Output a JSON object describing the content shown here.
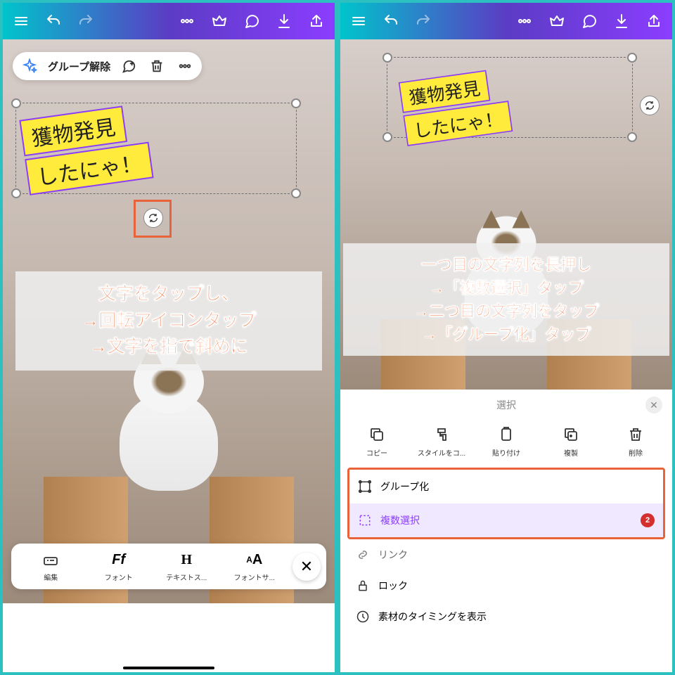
{
  "text_element": {
    "line1": "獲物発見",
    "line2": "したにゃ！"
  },
  "left": {
    "context_bar": {
      "ungroup": "グループ解除"
    },
    "instruction": {
      "l1": "文字をタップし、",
      "l2": "→回転アイコンタップ",
      "l3": "→文字を指で斜めに"
    },
    "tools": {
      "edit": "編集",
      "font": "フォント",
      "font_face": "Ff",
      "textstyle": "テキストス...",
      "textstyle_icon": "H",
      "fontsize": "フォントサ...",
      "fontsize_icon": "AA"
    }
  },
  "right": {
    "instruction": {
      "l1": "一つ目の文字列を長押し",
      "l2": "→「複数選択」タップ",
      "l3": "→二つ目の文字列をタップ",
      "l4": "→「グループ化」タップ"
    },
    "sheet": {
      "title": "選択",
      "copy": "コピー",
      "stylecopy": "スタイルをコ...",
      "paste": "貼り付け",
      "duplicate": "複製",
      "delete": "削除",
      "group": "グループ化",
      "multiselect": "複数選択",
      "badge": "2",
      "link": "リンク",
      "lock": "ロック",
      "timing": "素材のタイミングを表示"
    }
  }
}
